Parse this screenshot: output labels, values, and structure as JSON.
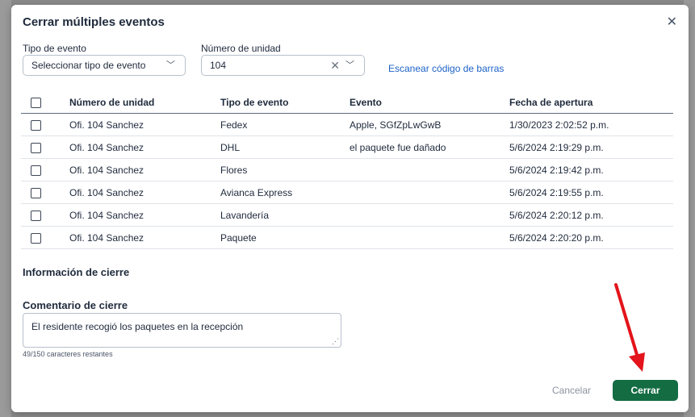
{
  "modal": {
    "title": "Cerrar múltiples eventos",
    "close_icon": "close-icon"
  },
  "filters": {
    "event_type": {
      "label": "Tipo de evento",
      "value": "Seleccionar tipo de evento"
    },
    "unit_number": {
      "label": "Número de unidad",
      "value": "104"
    },
    "scan_link": "Escanear código de barras"
  },
  "table": {
    "headers": [
      "Número de unidad",
      "Tipo de evento",
      "Evento",
      "Fecha de apertura"
    ],
    "rows": [
      {
        "unit": "Ofi. 104 Sanchez",
        "type": "Fedex",
        "event": "Apple, SGfZpLwGwB",
        "date": "1/30/2023 2:02:52 p.m."
      },
      {
        "unit": "Ofi. 104 Sanchez",
        "type": "DHL",
        "event": "el paquete fue dañado",
        "date": "5/6/2024 2:19:29 p.m."
      },
      {
        "unit": "Ofi. 104 Sanchez",
        "type": "Flores",
        "event": "",
        "date": "5/6/2024 2:19:42 p.m."
      },
      {
        "unit": "Ofi. 104 Sanchez",
        "type": "Avianca Express",
        "event": "",
        "date": "5/6/2024 2:19:55 p.m."
      },
      {
        "unit": "Ofi. 104 Sanchez",
        "type": "Lavandería",
        "event": "",
        "date": "5/6/2024 2:20:12 p.m."
      },
      {
        "unit": "Ofi. 104 Sanchez",
        "type": "Paquete",
        "event": "",
        "date": "5/6/2024 2:20:20 p.m."
      }
    ]
  },
  "closing": {
    "section_title": "Información de cierre",
    "comment_label": "Comentario de cierre",
    "comment_value": "El residente recogió los paquetes en la recepción",
    "counter": "49/150 caracteres restantes"
  },
  "footer": {
    "cancel_label": "Cancelar",
    "close_label": "Cerrar"
  },
  "colors": {
    "primary": "#146c43",
    "link": "#1d62c8",
    "annotation_arrow": "#e3141b"
  }
}
